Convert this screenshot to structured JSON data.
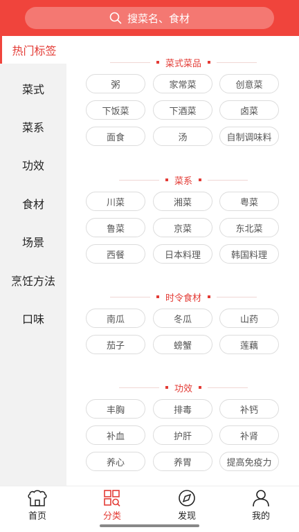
{
  "search": {
    "placeholder": "搜菜名、食材"
  },
  "sidebar": {
    "active": "热门标签",
    "items": [
      "菜式",
      "菜系",
      "功效",
      "食材",
      "场景",
      "烹饪方法",
      "口味"
    ]
  },
  "sections": [
    {
      "title": "菜式菜品",
      "tags": [
        "粥",
        "家常菜",
        "创意菜",
        "下饭菜",
        "下酒菜",
        "卤菜",
        "面食",
        "汤",
        "自制调味料"
      ]
    },
    {
      "title": "菜系",
      "tags": [
        "川菜",
        "湘菜",
        "粤菜",
        "鲁菜",
        "京菜",
        "东北菜",
        "西餐",
        "日本料理",
        "韩国料理"
      ]
    },
    {
      "title": "时令食材",
      "tags": [
        "南瓜",
        "冬瓜",
        "山药",
        "茄子",
        "螃蟹",
        "莲藕"
      ]
    },
    {
      "title": "功效",
      "tags": [
        "丰胸",
        "排毒",
        "补钙",
        "补血",
        "护肝",
        "补肾",
        "养心",
        "养胃",
        "提高免疫力"
      ]
    }
  ],
  "tabs": [
    {
      "label": "首页",
      "icon": "home-icon"
    },
    {
      "label": "分类",
      "icon": "category-icon",
      "active": true
    },
    {
      "label": "发现",
      "icon": "compass-icon"
    },
    {
      "label": "我的",
      "icon": "user-icon"
    }
  ],
  "colors": {
    "accent": "#f0443c",
    "sidebar_bg": "#f2f2f2"
  }
}
